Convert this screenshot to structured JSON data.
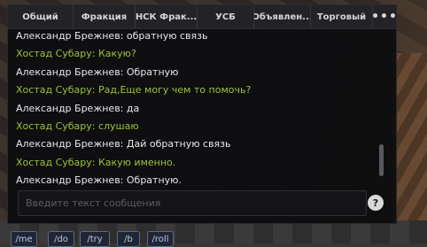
{
  "tabs": [
    {
      "label": "Общий"
    },
    {
      "label": "Фракция"
    },
    {
      "label": "НСК Фрак..."
    },
    {
      "label": "УСБ"
    },
    {
      "label": "Объявлен..."
    },
    {
      "label": "Торговый"
    }
  ],
  "more_label": "•••",
  "messages": [
    {
      "text": "Александр Брежнев: обратную связь",
      "color": "white"
    },
    {
      "text": "Хостад Субару: Какую?",
      "color": "green"
    },
    {
      "text": "Александр Брежнев: Обратную",
      "color": "white"
    },
    {
      "text": "Хостад Субару: Рад,Еще могу чем то помочь?",
      "color": "green"
    },
    {
      "text": "Александр Брежнев: да",
      "color": "white"
    },
    {
      "text": "Хостад Субару: слушаю",
      "color": "green"
    },
    {
      "text": "Александр Брежнев: Дай обратную связь",
      "color": "white"
    },
    {
      "text": "Хостад Субару: Какую именно.",
      "color": "green"
    },
    {
      "text": "Александр Брежнев: Обратную.",
      "color": "white"
    }
  ],
  "input": {
    "placeholder": "Введите текст сообщения",
    "value": ""
  },
  "help_label": "?",
  "commands": [
    "/me",
    "/do",
    "/try",
    "/b",
    "/roll"
  ],
  "colors": {
    "player_text": "#e9e9e9",
    "npc_text": "#9bc43a"
  }
}
